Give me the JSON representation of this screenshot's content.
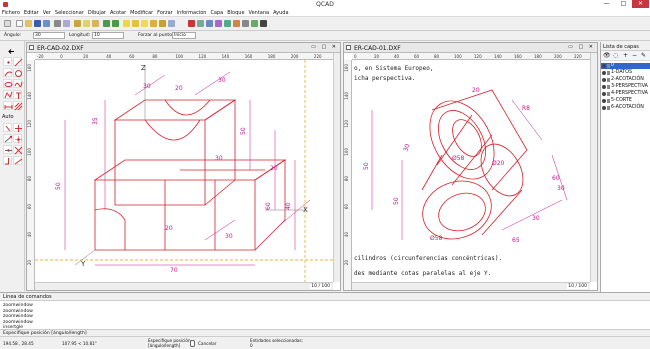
{
  "app": {
    "title": "QCAD"
  },
  "window_controls": {
    "minimize": "—",
    "maximize": "□",
    "close": "✕"
  },
  "menu": [
    "Fichero",
    "Editar",
    "Ver",
    "Seleccionar",
    "Dibujar",
    "Acotar",
    "Modificar",
    "Forzar",
    "Información",
    "Capa",
    "Bloque",
    "Ventana",
    "Ayuda"
  ],
  "options": {
    "angle_label": "Ángulo:",
    "angle_value": "30",
    "length_label": "Longitud:",
    "length_value": "10",
    "snap_label": "Forzar al punto:",
    "snap_value": "Inicio"
  },
  "left_panel": {
    "auto_label": "Auto"
  },
  "doc_left": {
    "title": "ER-CAD-02.DXF",
    "ruler_x": [
      "-20",
      "0",
      "20",
      "40",
      "60",
      "80",
      "100",
      "120",
      "140",
      "160",
      "180",
      "200",
      "220"
    ],
    "ruler_y": [
      "160",
      "140",
      "120",
      "100",
      "80",
      "60",
      "40",
      "20"
    ],
    "zoom": "10 / 100",
    "labels": {
      "z": "Z",
      "y": "Y",
      "x": "X"
    },
    "dims": [
      "35",
      "30",
      "20",
      "30",
      "50",
      "30",
      "20",
      "50",
      "60",
      "20",
      "40",
      "30",
      "70"
    ]
  },
  "doc_right": {
    "title": "ER-CAD-01.DXF",
    "ruler_x": [
      "0",
      "20",
      "40",
      "60",
      "80",
      "100",
      "120",
      "140",
      "160",
      "180",
      "200",
      "220"
    ],
    "ruler_y": [
      "160",
      "140",
      "120",
      "100",
      "80",
      "60",
      "40",
      "20"
    ],
    "zoom": "10 / 100",
    "text_lines": [
      "o, en Sistema Europeo,",
      "icha perspectiva.",
      "cilindros (circunferencias concéntricas).",
      "des mediante cotas paralelas al eje Y."
    ],
    "dims": [
      "30",
      "20",
      "R8",
      "Ø58",
      "50",
      "Ø20",
      "50",
      "Ø58",
      "60",
      "30",
      "65",
      "30"
    ]
  },
  "layers": {
    "title": "Lista de capas",
    "items": [
      "0",
      "1-DATOS",
      "2-ACOTACIÓN",
      "3-PERSPECTIVA",
      "4-PERSPECTIVA",
      "5-CORTE",
      "6-ACOTACIÓN"
    ],
    "selected": 0
  },
  "command": {
    "title": "Línea de comandos",
    "history": [
      "zoomwindow",
      "zoomwindow",
      "zoomwindow",
      "zoomwindow",
      "insertgle"
    ],
    "prompt": "Especifique posición [ángulo/length]"
  },
  "status": {
    "coord_abs": "194.58 , 28.45",
    "coord_rel": "107.95 < 10.81°",
    "mouse_left": "Especifique posición",
    "mouse_left2": "[ángulo/length]",
    "mouse_right": "Cancelar",
    "selected_label": "Entidades seleccionadas:",
    "selected_count": "0"
  },
  "colors": {
    "drawing": "#d8202a",
    "dims": "#c2188f",
    "axis": "#e0a000",
    "layer_sel": "#3266cc"
  }
}
